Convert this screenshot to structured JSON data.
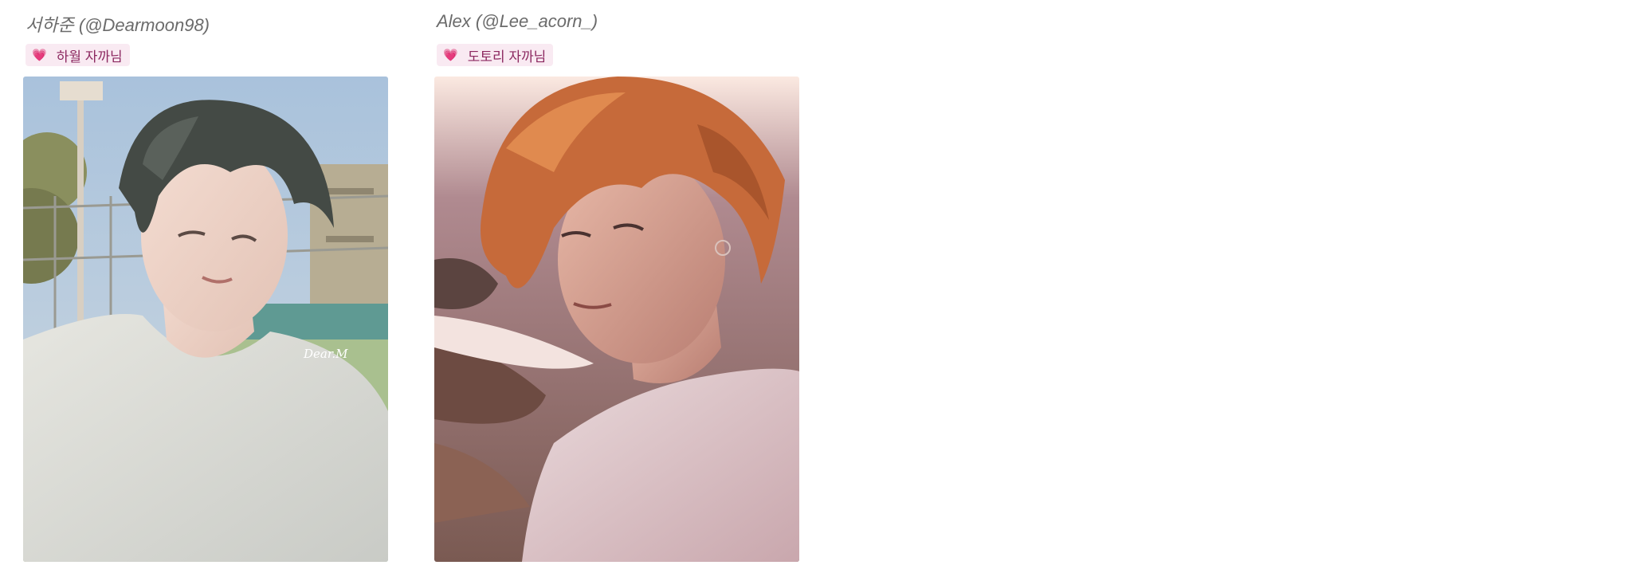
{
  "cards": [
    {
      "author": "서하준 (@Dearmoon98)",
      "tag": {
        "icon": "heart-icon",
        "label": "하월 자까님"
      },
      "image": {
        "watermark": "Dear.M"
      }
    },
    {
      "author": "Alex (@Lee_acorn_)",
      "tag": {
        "icon": "heart-icon",
        "label": "도토리 자까님"
      },
      "image": {}
    }
  ],
  "colors": {
    "tag_bg": "#f9eaf2",
    "tag_text": "#8c2860",
    "heart": "#c44a9b",
    "author_text": "#6b6b6b"
  }
}
